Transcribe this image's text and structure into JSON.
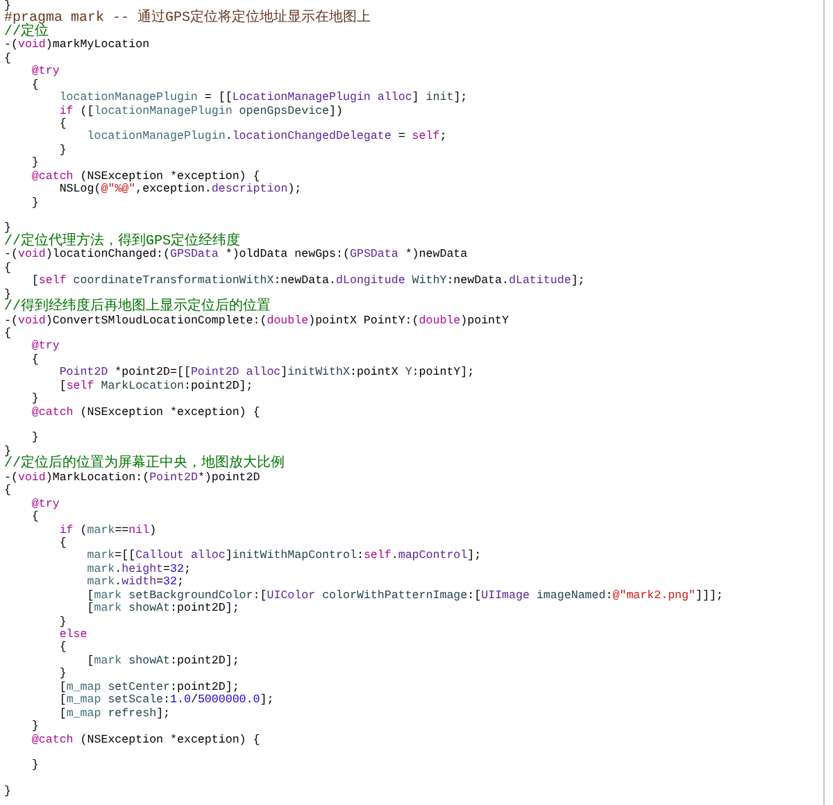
{
  "editor": {
    "lines": [
      {
        "kind": "code",
        "tokens": [
          {
            "kind": "plain",
            "text": "}"
          }
        ]
      },
      {
        "kind": "code",
        "tokens": [
          {
            "kind": "directive",
            "text": "#pragma mark -- 通过GPS定位将定位地址显示在地图上"
          }
        ]
      },
      {
        "kind": "code",
        "tokens": [
          {
            "kind": "comment",
            "text": "//定位"
          }
        ]
      },
      {
        "kind": "code",
        "tokens": [
          {
            "kind": "plain",
            "text": "-("
          },
          {
            "kind": "keyword",
            "text": "void"
          },
          {
            "kind": "plain",
            "text": ")markMyLocation"
          }
        ]
      },
      {
        "kind": "code",
        "tokens": [
          {
            "kind": "plain",
            "text": "{"
          }
        ]
      },
      {
        "kind": "code",
        "tokens": [
          {
            "kind": "keyword",
            "text": "    @try"
          }
        ]
      },
      {
        "kind": "code",
        "tokens": [
          {
            "kind": "plain",
            "text": "    {"
          }
        ]
      },
      {
        "kind": "code",
        "tokens": [
          {
            "kind": "variable",
            "text": "        locationManagePlugin"
          },
          {
            "kind": "plain",
            "text": " = [["
          },
          {
            "kind": "type",
            "text": "LocationManagePlugin"
          },
          {
            "kind": "type",
            "text": " alloc"
          },
          {
            "kind": "plain",
            "text": "] "
          },
          {
            "kind": "method",
            "text": "init"
          },
          {
            "kind": "plain",
            "text": "];"
          }
        ]
      },
      {
        "kind": "code",
        "tokens": [
          {
            "kind": "keyword",
            "text": "        if"
          },
          {
            "kind": "plain",
            "text": " (["
          },
          {
            "kind": "variable",
            "text": "locationManagePlugin"
          },
          {
            "kind": "method",
            "text": " openGpsDevice"
          },
          {
            "kind": "plain",
            "text": "])"
          }
        ]
      },
      {
        "kind": "code",
        "tokens": [
          {
            "kind": "plain",
            "text": "        {"
          }
        ]
      },
      {
        "kind": "code",
        "tokens": [
          {
            "kind": "variable",
            "text": "            locationManagePlugin"
          },
          {
            "kind": "plain",
            "text": "."
          },
          {
            "kind": "property",
            "text": "locationChangedDelegate"
          },
          {
            "kind": "plain",
            "text": " = "
          },
          {
            "kind": "keyword",
            "text": "self"
          },
          {
            "kind": "plain",
            "text": ";"
          }
        ]
      },
      {
        "kind": "code",
        "tokens": [
          {
            "kind": "plain",
            "text": "        }"
          }
        ]
      },
      {
        "kind": "code",
        "tokens": [
          {
            "kind": "plain",
            "text": "    }"
          }
        ]
      },
      {
        "kind": "code",
        "tokens": [
          {
            "kind": "keyword",
            "text": "    @catch"
          },
          {
            "kind": "plain",
            "text": " (NSException *exception) {"
          }
        ]
      },
      {
        "kind": "code",
        "tokens": [
          {
            "kind": "plain",
            "text": "        NSLog("
          },
          {
            "kind": "string",
            "text": "@\"%@\""
          },
          {
            "kind": "plain",
            "text": ",exception."
          },
          {
            "kind": "property",
            "text": "description"
          },
          {
            "kind": "plain",
            "text": ");"
          }
        ]
      },
      {
        "kind": "code",
        "tokens": [
          {
            "kind": "plain",
            "text": "    }"
          }
        ]
      },
      {
        "kind": "blank"
      },
      {
        "kind": "code",
        "tokens": [
          {
            "kind": "plain",
            "text": "}"
          }
        ]
      },
      {
        "kind": "code",
        "tokens": [
          {
            "kind": "comment",
            "text": "//定位代理方法，得到GPS定位经纬度"
          }
        ]
      },
      {
        "kind": "code",
        "tokens": [
          {
            "kind": "plain",
            "text": "-("
          },
          {
            "kind": "keyword",
            "text": "void"
          },
          {
            "kind": "plain",
            "text": ")locationChanged:("
          },
          {
            "kind": "type",
            "text": "GPSData"
          },
          {
            "kind": "plain",
            "text": " *)oldData newGps:("
          },
          {
            "kind": "type",
            "text": "GPSData"
          },
          {
            "kind": "plain",
            "text": " *)newData"
          }
        ]
      },
      {
        "kind": "code",
        "tokens": [
          {
            "kind": "plain",
            "text": "{"
          }
        ]
      },
      {
        "kind": "code",
        "tokens": [
          {
            "kind": "plain",
            "text": "    ["
          },
          {
            "kind": "keyword",
            "text": "self"
          },
          {
            "kind": "method",
            "text": " coordinateTransformationWithX"
          },
          {
            "kind": "plain",
            "text": ":newData."
          },
          {
            "kind": "property",
            "text": "dLongitude"
          },
          {
            "kind": "method",
            "text": " WithY"
          },
          {
            "kind": "plain",
            "text": ":newData."
          },
          {
            "kind": "property",
            "text": "dLatitude"
          },
          {
            "kind": "plain",
            "text": "];"
          }
        ]
      },
      {
        "kind": "code",
        "tokens": [
          {
            "kind": "plain",
            "text": "}"
          }
        ]
      },
      {
        "kind": "code",
        "tokens": [
          {
            "kind": "comment",
            "text": "//得到经纬度后再地图上显示定位后的位置"
          }
        ]
      },
      {
        "kind": "code",
        "tokens": [
          {
            "kind": "plain",
            "text": "-("
          },
          {
            "kind": "keyword",
            "text": "void"
          },
          {
            "kind": "plain",
            "text": ")ConvertSMloudLocationComplete:("
          },
          {
            "kind": "keyword",
            "text": "double"
          },
          {
            "kind": "plain",
            "text": ")pointX PointY:("
          },
          {
            "kind": "keyword",
            "text": "double"
          },
          {
            "kind": "plain",
            "text": ")pointY"
          }
        ]
      },
      {
        "kind": "code",
        "tokens": [
          {
            "kind": "plain",
            "text": "{"
          }
        ]
      },
      {
        "kind": "code",
        "tokens": [
          {
            "kind": "keyword",
            "text": "    @try"
          }
        ]
      },
      {
        "kind": "code",
        "tokens": [
          {
            "kind": "plain",
            "text": "    {"
          }
        ]
      },
      {
        "kind": "code",
        "tokens": [
          {
            "kind": "type",
            "text": "        Point2D"
          },
          {
            "kind": "plain",
            "text": " *point2D=[["
          },
          {
            "kind": "type",
            "text": "Point2D alloc"
          },
          {
            "kind": "plain",
            "text": "]"
          },
          {
            "kind": "method",
            "text": "initWithX"
          },
          {
            "kind": "plain",
            "text": ":pointX "
          },
          {
            "kind": "method",
            "text": "Y"
          },
          {
            "kind": "plain",
            "text": ":pointY];"
          }
        ]
      },
      {
        "kind": "code",
        "tokens": [
          {
            "kind": "plain",
            "text": "        ["
          },
          {
            "kind": "keyword",
            "text": "self"
          },
          {
            "kind": "method",
            "text": " MarkLocation"
          },
          {
            "kind": "plain",
            "text": ":point2D];"
          }
        ]
      },
      {
        "kind": "code",
        "tokens": [
          {
            "kind": "plain",
            "text": "    }"
          }
        ]
      },
      {
        "kind": "code",
        "tokens": [
          {
            "kind": "keyword",
            "text": "    @catch"
          },
          {
            "kind": "plain",
            "text": " (NSException *exception) {"
          }
        ]
      },
      {
        "kind": "blank"
      },
      {
        "kind": "code",
        "tokens": [
          {
            "kind": "plain",
            "text": "    }"
          }
        ]
      },
      {
        "kind": "code",
        "tokens": [
          {
            "kind": "plain",
            "text": "}"
          }
        ]
      },
      {
        "kind": "code",
        "tokens": [
          {
            "kind": "comment",
            "text": "//定位后的位置为屏幕正中央，地图放大比例"
          }
        ]
      },
      {
        "kind": "code",
        "tokens": [
          {
            "kind": "plain",
            "text": "-("
          },
          {
            "kind": "keyword",
            "text": "void"
          },
          {
            "kind": "plain",
            "text": ")MarkLocation:("
          },
          {
            "kind": "type",
            "text": "Point2D"
          },
          {
            "kind": "plain",
            "text": "*)point2D"
          }
        ]
      },
      {
        "kind": "code",
        "tokens": [
          {
            "kind": "plain",
            "text": "{"
          }
        ]
      },
      {
        "kind": "code",
        "tokens": [
          {
            "kind": "keyword",
            "text": "    @try"
          }
        ]
      },
      {
        "kind": "code",
        "tokens": [
          {
            "kind": "plain",
            "text": "    {"
          }
        ]
      },
      {
        "kind": "code",
        "tokens": [
          {
            "kind": "keyword",
            "text": "        if"
          },
          {
            "kind": "plain",
            "text": " ("
          },
          {
            "kind": "variable",
            "text": "mark"
          },
          {
            "kind": "plain",
            "text": "=="
          },
          {
            "kind": "keyword",
            "text": "nil"
          },
          {
            "kind": "plain",
            "text": ")"
          }
        ]
      },
      {
        "kind": "code",
        "tokens": [
          {
            "kind": "plain",
            "text": "        {"
          }
        ]
      },
      {
        "kind": "code",
        "tokens": [
          {
            "kind": "variable",
            "text": "            mark"
          },
          {
            "kind": "plain",
            "text": "=[["
          },
          {
            "kind": "type",
            "text": "Callout alloc"
          },
          {
            "kind": "plain",
            "text": "]"
          },
          {
            "kind": "method",
            "text": "initWithMapControl"
          },
          {
            "kind": "plain",
            "text": ":"
          },
          {
            "kind": "keyword",
            "text": "self"
          },
          {
            "kind": "plain",
            "text": "."
          },
          {
            "kind": "property",
            "text": "mapControl"
          },
          {
            "kind": "plain",
            "text": "];"
          }
        ]
      },
      {
        "kind": "code",
        "tokens": [
          {
            "kind": "variable",
            "text": "            mark"
          },
          {
            "kind": "plain",
            "text": "."
          },
          {
            "kind": "property",
            "text": "height"
          },
          {
            "kind": "plain",
            "text": "="
          },
          {
            "kind": "number",
            "text": "32"
          },
          {
            "kind": "plain",
            "text": ";"
          }
        ]
      },
      {
        "kind": "code",
        "tokens": [
          {
            "kind": "variable",
            "text": "            mark"
          },
          {
            "kind": "plain",
            "text": "."
          },
          {
            "kind": "property",
            "text": "width"
          },
          {
            "kind": "plain",
            "text": "="
          },
          {
            "kind": "number",
            "text": "32"
          },
          {
            "kind": "plain",
            "text": ";"
          }
        ]
      },
      {
        "kind": "code",
        "tokens": [
          {
            "kind": "plain",
            "text": "            ["
          },
          {
            "kind": "variable",
            "text": "mark"
          },
          {
            "kind": "method",
            "text": " setBackgroundColor"
          },
          {
            "kind": "plain",
            "text": ":["
          },
          {
            "kind": "type",
            "text": "UIColor"
          },
          {
            "kind": "method",
            "text": " colorWithPatternImage"
          },
          {
            "kind": "plain",
            "text": ":["
          },
          {
            "kind": "type",
            "text": "UIImage"
          },
          {
            "kind": "method",
            "text": " imageNamed"
          },
          {
            "kind": "plain",
            "text": ":"
          },
          {
            "kind": "string",
            "text": "@\"mark2.png\""
          },
          {
            "kind": "plain",
            "text": "]]];"
          }
        ]
      },
      {
        "kind": "code",
        "tokens": [
          {
            "kind": "plain",
            "text": "            ["
          },
          {
            "kind": "variable",
            "text": "mark"
          },
          {
            "kind": "method",
            "text": " showAt"
          },
          {
            "kind": "plain",
            "text": ":point2D];"
          }
        ]
      },
      {
        "kind": "code",
        "tokens": [
          {
            "kind": "plain",
            "text": "        }"
          }
        ]
      },
      {
        "kind": "code",
        "tokens": [
          {
            "kind": "keyword",
            "text": "        else"
          }
        ]
      },
      {
        "kind": "code",
        "tokens": [
          {
            "kind": "plain",
            "text": "        {"
          }
        ]
      },
      {
        "kind": "code",
        "tokens": [
          {
            "kind": "plain",
            "text": "            ["
          },
          {
            "kind": "variable",
            "text": "mark"
          },
          {
            "kind": "method",
            "text": " showAt"
          },
          {
            "kind": "plain",
            "text": ":point2D];"
          }
        ]
      },
      {
        "kind": "code",
        "tokens": [
          {
            "kind": "plain",
            "text": "        }"
          }
        ]
      },
      {
        "kind": "code",
        "tokens": [
          {
            "kind": "plain",
            "text": "        ["
          },
          {
            "kind": "variable",
            "text": "m_map"
          },
          {
            "kind": "method",
            "text": " setCenter"
          },
          {
            "kind": "plain",
            "text": ":point2D];"
          }
        ]
      },
      {
        "kind": "code",
        "tokens": [
          {
            "kind": "plain",
            "text": "        ["
          },
          {
            "kind": "variable",
            "text": "m_map"
          },
          {
            "kind": "method",
            "text": " setScale"
          },
          {
            "kind": "plain",
            "text": ":"
          },
          {
            "kind": "number",
            "text": "1.0"
          },
          {
            "kind": "plain",
            "text": "/"
          },
          {
            "kind": "number",
            "text": "5000000.0"
          },
          {
            "kind": "plain",
            "text": "];"
          }
        ]
      },
      {
        "kind": "code",
        "tokens": [
          {
            "kind": "plain",
            "text": "        ["
          },
          {
            "kind": "variable",
            "text": "m_map"
          },
          {
            "kind": "method",
            "text": " refresh"
          },
          {
            "kind": "plain",
            "text": "];"
          }
        ]
      },
      {
        "kind": "code",
        "tokens": [
          {
            "kind": "plain",
            "text": "    }"
          }
        ]
      },
      {
        "kind": "code",
        "tokens": [
          {
            "kind": "keyword",
            "text": "    @catch"
          },
          {
            "kind": "plain",
            "text": " (NSException *exception) {"
          }
        ]
      },
      {
        "kind": "blank"
      },
      {
        "kind": "code",
        "tokens": [
          {
            "kind": "plain",
            "text": "    }"
          }
        ]
      },
      {
        "kind": "blank"
      },
      {
        "kind": "code",
        "tokens": [
          {
            "kind": "plain",
            "text": "}"
          }
        ]
      }
    ]
  }
}
